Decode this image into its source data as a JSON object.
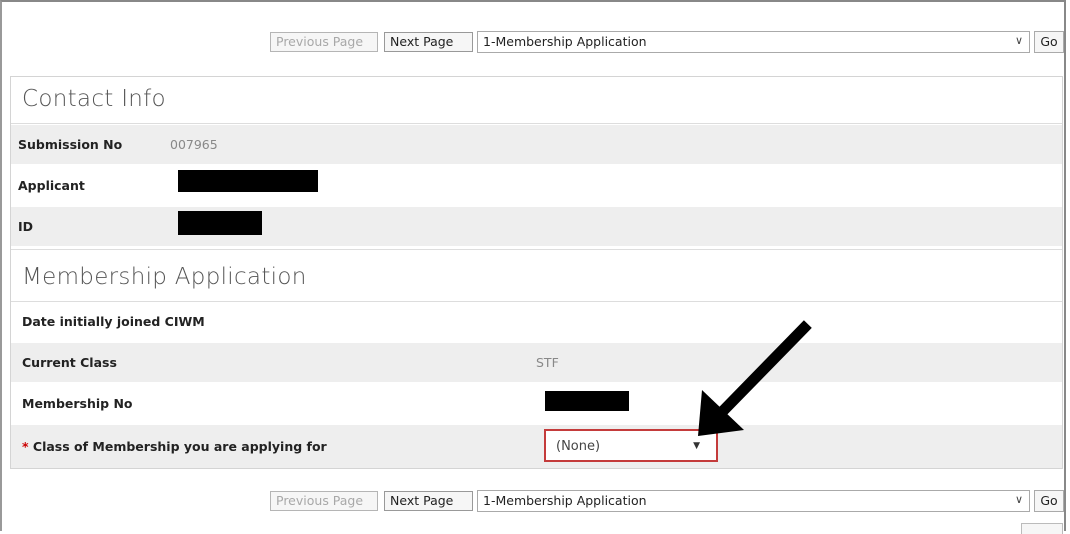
{
  "nav": {
    "previous_label": "Previous Page",
    "next_label": "Next Page",
    "page_select_value": "1-Membership Application",
    "go_label": "Go"
  },
  "contact_info": {
    "title": "Contact Info",
    "rows": [
      {
        "label": "Submission No",
        "value": "007965"
      },
      {
        "label": "Applicant",
        "value": ""
      },
      {
        "label": "ID",
        "value": ""
      }
    ]
  },
  "membership_application": {
    "title": "Membership Application",
    "rows": [
      {
        "label": "Date initially joined CIWM",
        "value": ""
      },
      {
        "label": "Current Class",
        "value": "STF"
      },
      {
        "label": "Membership No",
        "value": ""
      }
    ],
    "class_field": {
      "required_mark": "*",
      "label": "Class of Membership you are applying for",
      "selected": "(None)"
    }
  },
  "colors": {
    "required": "#cc0000",
    "highlight_border": "#c43b3b",
    "row_shade": "#eeeeee"
  },
  "icons": [
    "chevron-down-icon",
    "dropdown-arrow-icon",
    "annotation-arrow-icon"
  ]
}
